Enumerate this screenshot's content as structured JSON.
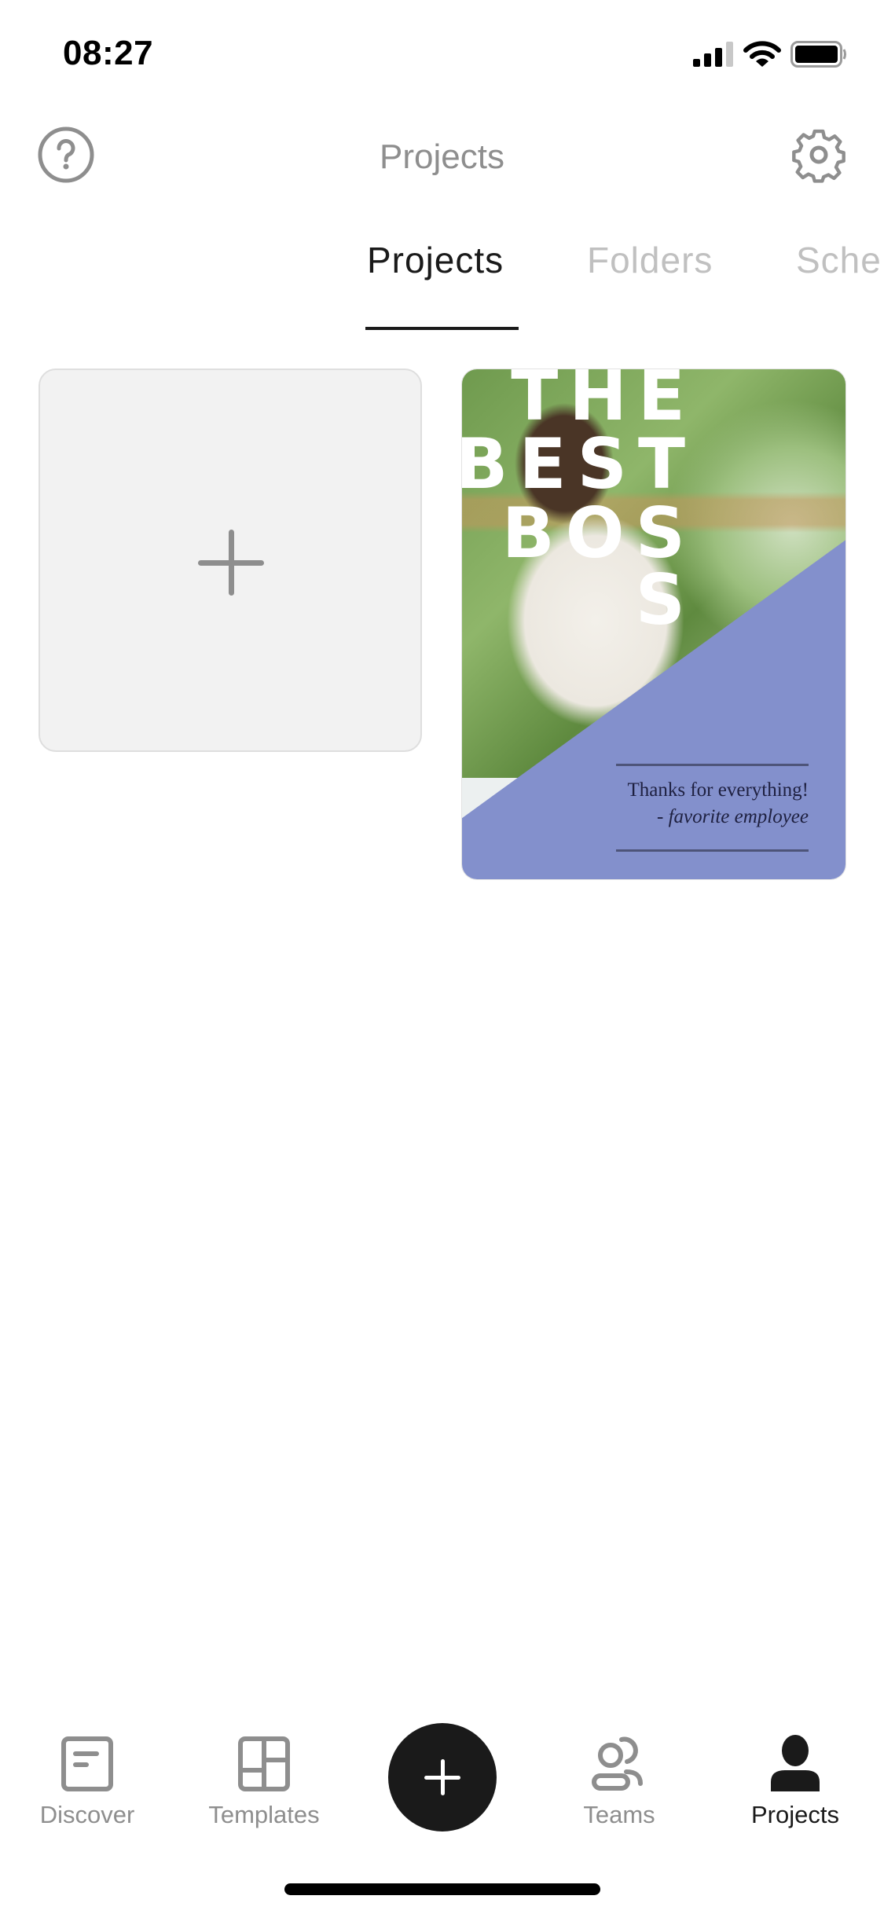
{
  "status_bar": {
    "time": "08:27",
    "signal_bars_filled": 3,
    "signal_bars_total": 4,
    "battery_level_percent": 95,
    "icons": [
      "signal-icon",
      "wifi-icon",
      "battery-icon"
    ]
  },
  "header": {
    "title": "Projects",
    "left_icon": "help-circle-icon",
    "right_icon": "gear-icon"
  },
  "tabs": [
    {
      "label": "Projects",
      "active": true
    },
    {
      "label": "Folders",
      "active": false
    },
    {
      "label": "Sche",
      "active": false
    }
  ],
  "projects": {
    "new_project_icon": "plus-icon",
    "items": [
      {
        "headline_lines": [
          "THE",
          "BEST",
          "BOS",
          "S"
        ],
        "message": "Thanks for everything!",
        "signature": "- favorite employee",
        "accent_color": "#8390cc"
      }
    ]
  },
  "bottom_nav": {
    "items": [
      {
        "label": "Discover",
        "icon": "discover-icon",
        "active": false
      },
      {
        "label": "Templates",
        "icon": "templates-icon",
        "active": false
      },
      {
        "label": "Teams",
        "icon": "teams-icon",
        "active": false
      },
      {
        "label": "Projects",
        "icon": "person-icon",
        "active": true
      }
    ],
    "fab_icon": "plus-icon"
  },
  "colors": {
    "active_text": "#1a1a1a",
    "inactive_icon": "#8e8e8e",
    "inactive_tab": "#c0c0c0",
    "card_bg": "#f2f2f2"
  }
}
